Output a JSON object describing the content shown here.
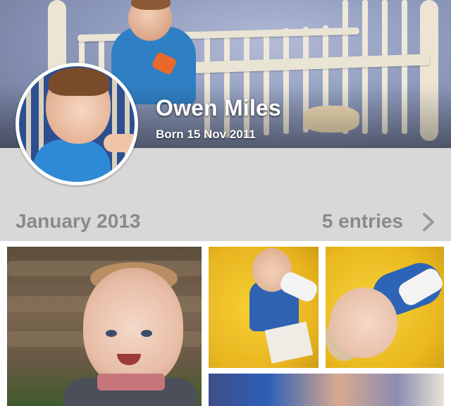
{
  "profile": {
    "name": "Owen Miles",
    "born": "Born 15 Nov 2011"
  },
  "timeline": {
    "month": "January 2013",
    "entries": "5 entries"
  },
  "icons": {
    "chevron": "chevron-right-icon"
  },
  "colors": {
    "background": "#d8d8d8",
    "header_text": "#8a8a8a",
    "name_text": "#ffffff"
  }
}
